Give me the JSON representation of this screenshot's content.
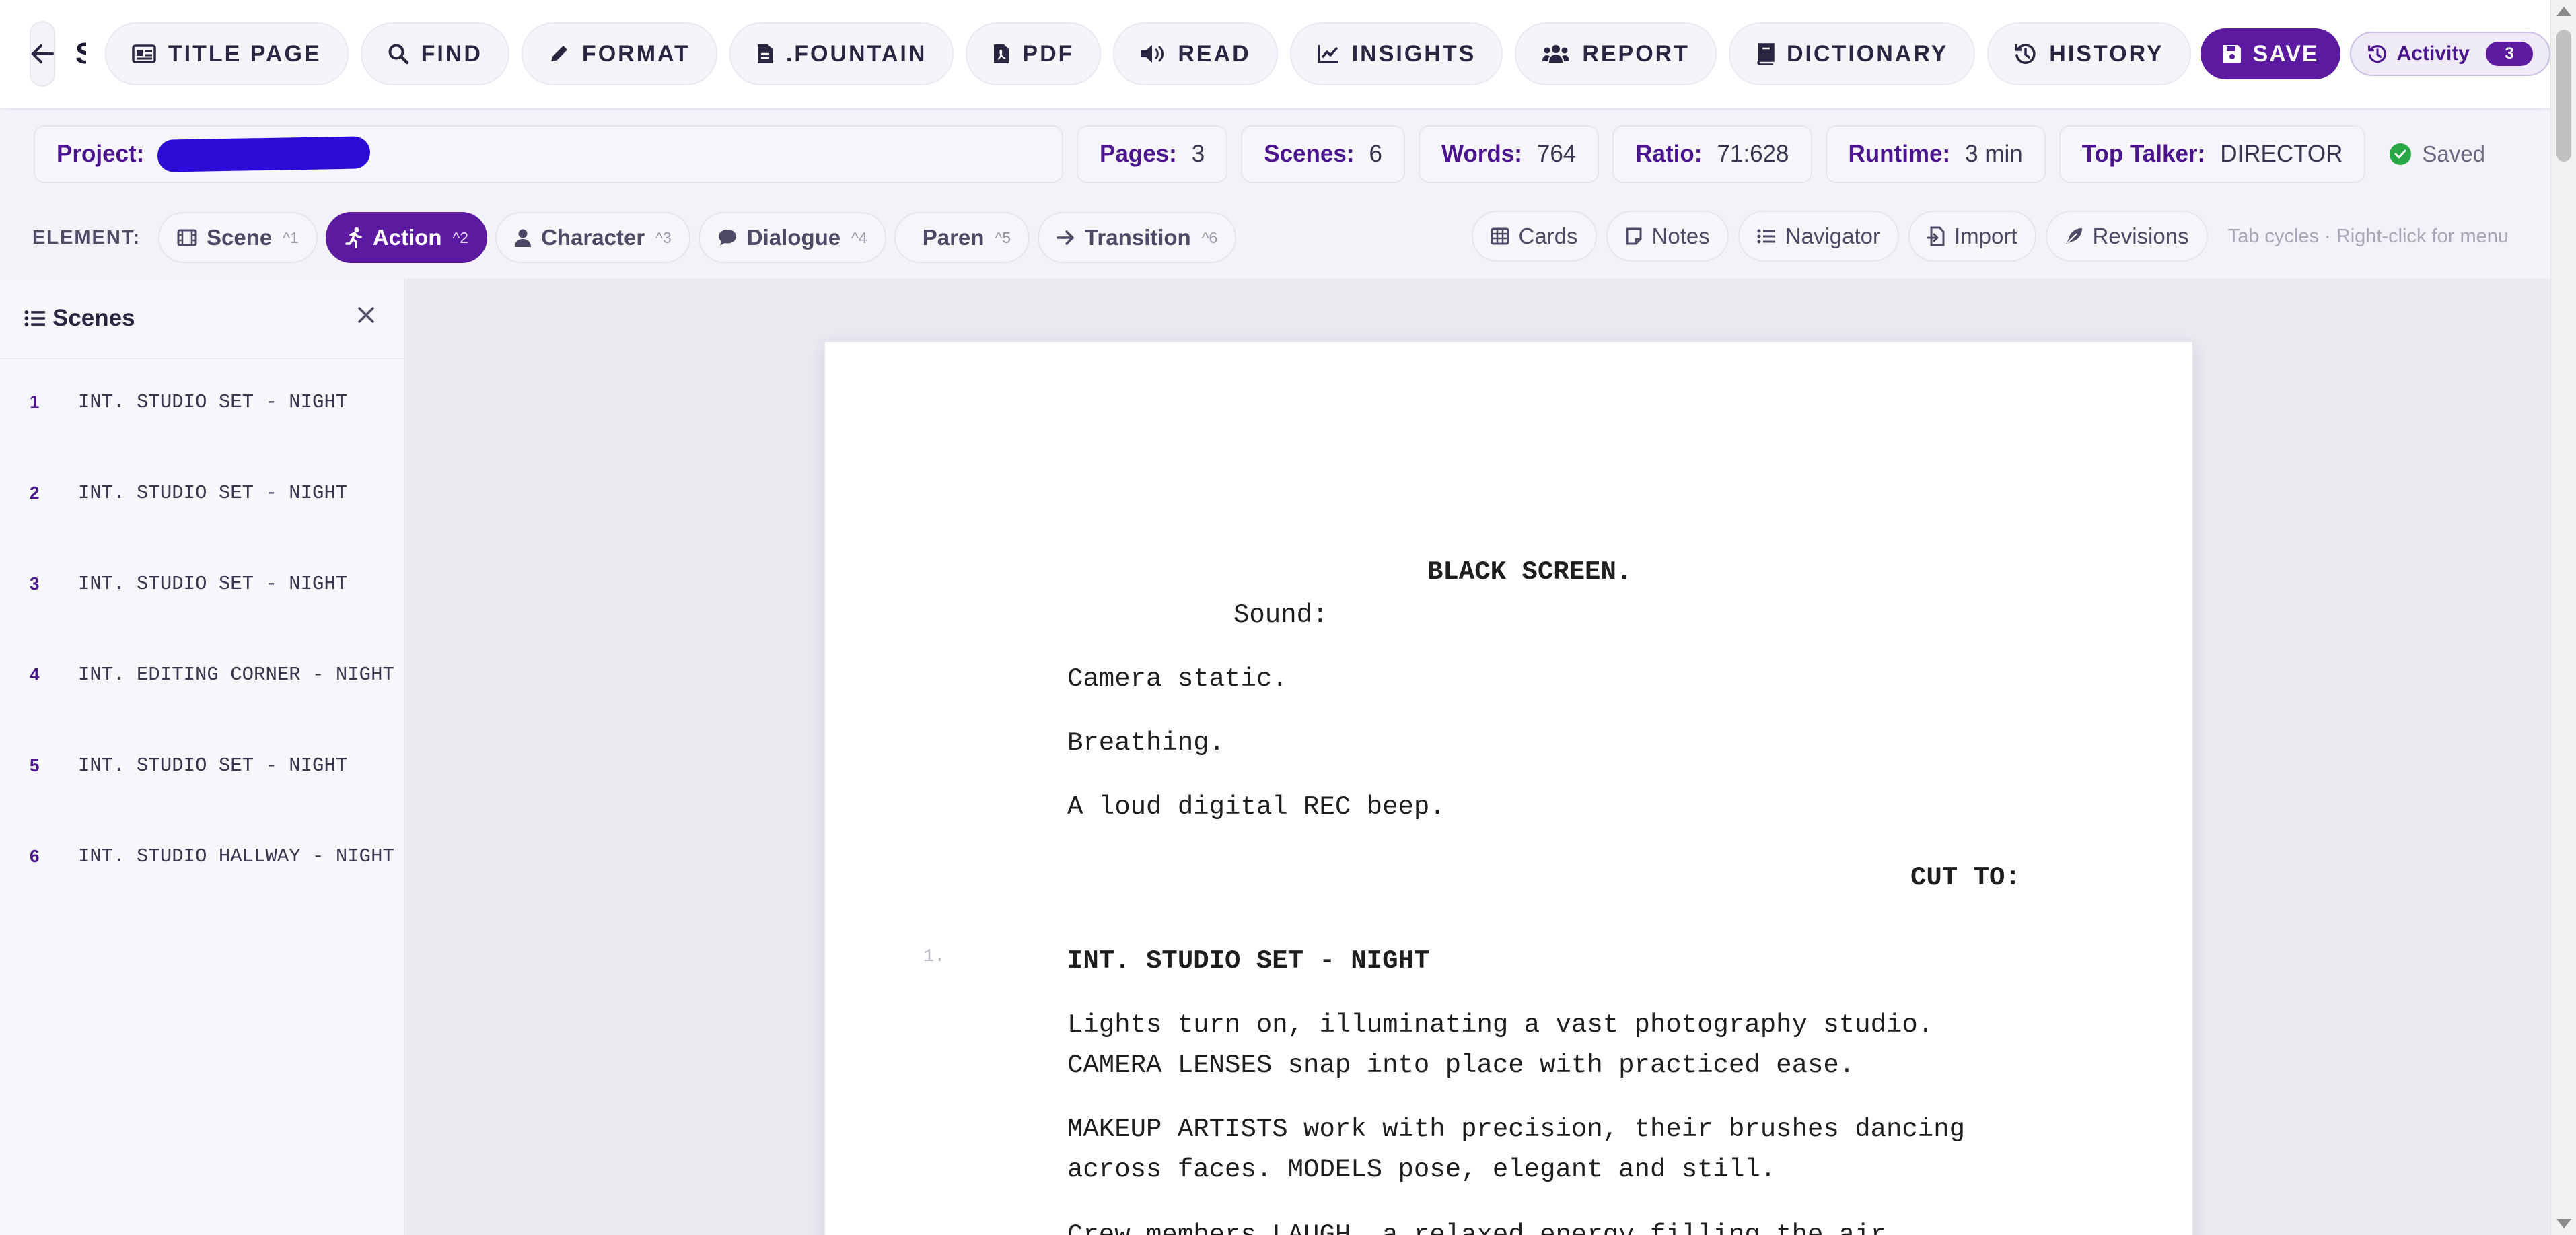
{
  "app": {
    "title": "Sc..."
  },
  "toolbar": {
    "buttons": [
      {
        "label": "TITLE PAGE",
        "icon": "id-card-icon"
      },
      {
        "label": "FIND",
        "icon": "search-icon"
      },
      {
        "label": "FORMAT",
        "icon": "pencil-icon"
      },
      {
        "label": ".FOUNTAIN",
        "icon": "file-icon"
      },
      {
        "label": "PDF",
        "icon": "pdf-file-icon"
      },
      {
        "label": "READ",
        "icon": "speaker-icon"
      },
      {
        "label": "INSIGHTS",
        "icon": "line-chart-icon"
      },
      {
        "label": "REPORT",
        "icon": "users-icon"
      },
      {
        "label": "DICTIONARY",
        "icon": "book-icon"
      },
      {
        "label": "HISTORY",
        "icon": "history-icon"
      }
    ],
    "save_label": "SAVE",
    "activity_label": "Activity",
    "activity_count": "3"
  },
  "stats": {
    "project_label": "Project:",
    "items": [
      {
        "key": "Pages:",
        "value": "3"
      },
      {
        "key": "Scenes:",
        "value": "6"
      },
      {
        "key": "Words:",
        "value": "764"
      },
      {
        "key": "Ratio:",
        "value": "71:628"
      },
      {
        "key": "Runtime:",
        "value": "3 min"
      },
      {
        "key": "Top Talker:",
        "value": "DIRECTOR"
      }
    ],
    "saved_label": "Saved"
  },
  "elements": {
    "label": "ELEMENT:",
    "items": [
      {
        "label": "Scene",
        "shortcut": "^1",
        "icon": "film-icon",
        "active": false
      },
      {
        "label": "Action",
        "shortcut": "^2",
        "icon": "running-icon",
        "active": true
      },
      {
        "label": "Character",
        "shortcut": "^3",
        "icon": "user-icon",
        "active": false
      },
      {
        "label": "Dialogue",
        "shortcut": "^4",
        "icon": "speech-bubble-icon",
        "active": false
      },
      {
        "label": "Paren",
        "shortcut": "^5",
        "icon": "",
        "active": false
      },
      {
        "label": "Transition",
        "shortcut": "^6",
        "icon": "arrow-right-icon",
        "active": false
      }
    ],
    "tools": [
      {
        "label": "Cards",
        "icon": "table-icon"
      },
      {
        "label": "Notes",
        "icon": "note-icon"
      },
      {
        "label": "Navigator",
        "icon": "list-icon"
      },
      {
        "label": "Import",
        "icon": "import-icon"
      },
      {
        "label": "Revisions",
        "icon": "feather-icon"
      }
    ],
    "hint": "Tab cycles · Right-click for menu"
  },
  "sidebar": {
    "title": "Scenes",
    "scenes": [
      {
        "num": "1",
        "heading": "INT. STUDIO SET - NIGHT"
      },
      {
        "num": "2",
        "heading": "INT. STUDIO SET - NIGHT"
      },
      {
        "num": "3",
        "heading": "INT. STUDIO SET - NIGHT"
      },
      {
        "num": "4",
        "heading": "INT. EDITING CORNER - NIGHT"
      },
      {
        "num": "5",
        "heading": "INT. STUDIO SET - NIGHT"
      },
      {
        "num": "6",
        "heading": "INT. STUDIO HALLWAY - NIGHT"
      }
    ]
  },
  "script": {
    "black_screen": "BLACK SCREEN.",
    "sound": "Sound:",
    "action_1": "Camera static.",
    "action_2": "Breathing.",
    "action_3": "A loud digital REC beep.",
    "transition_1": "CUT TO:",
    "scene_mark_1": "1.",
    "scene_heading_1": "INT. STUDIO SET - NIGHT",
    "action_4_line1": "Lights turn on, illuminating a vast photography studio.",
    "action_4_line2": "CAMERA LENSES snap into place with practiced ease.",
    "action_5_line1": "MAKEUP ARTISTS work with precision, their brushes dancing",
    "action_5_line2": "across faces. MODELS pose, elegant and still.",
    "action_6_line1": "Crew members LAUGH, a relaxed energy filling the air."
  }
}
